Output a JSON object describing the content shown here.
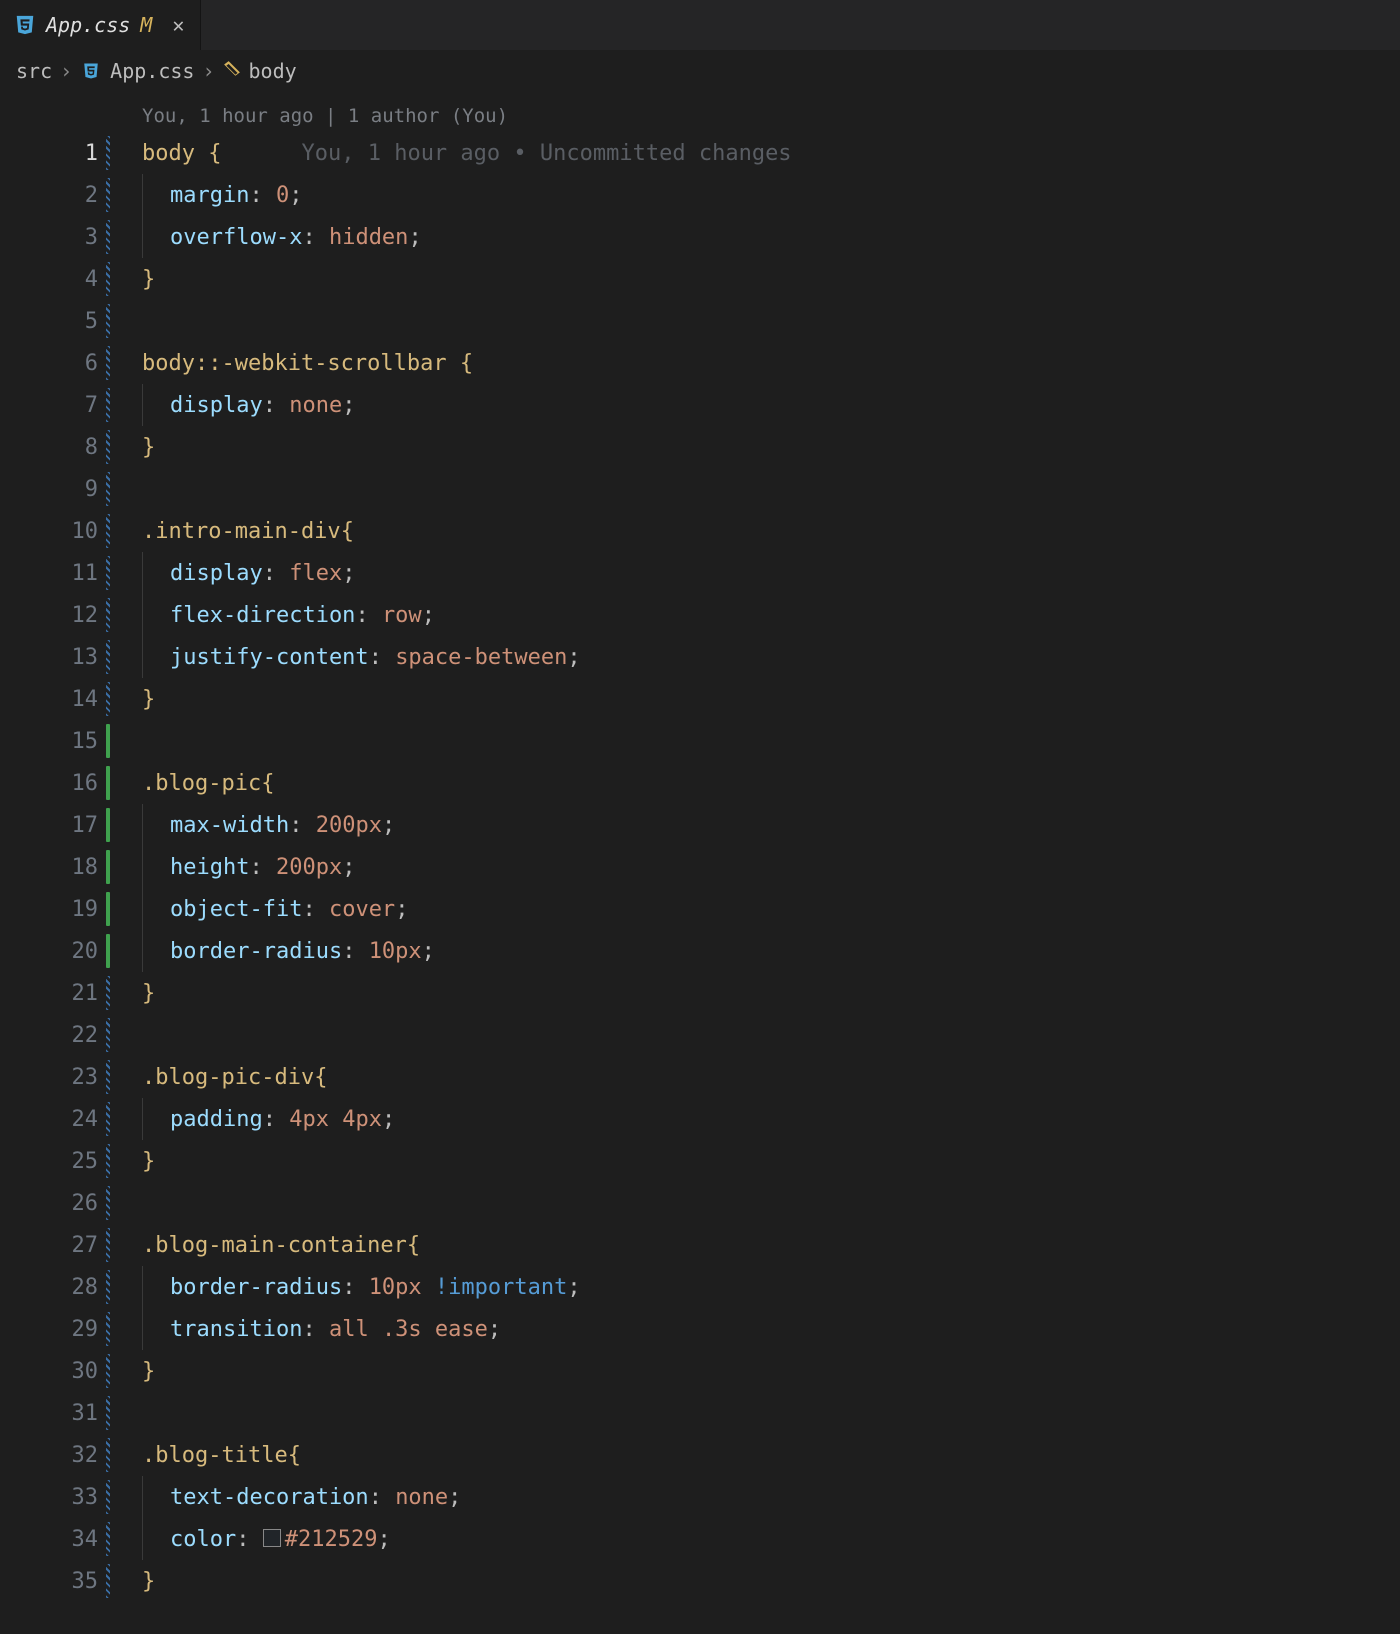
{
  "tab": {
    "filename": "App.css",
    "gitStatus": "M"
  },
  "breadcrumbs": {
    "folder": "src",
    "file": "App.css",
    "symbol": "body"
  },
  "gitlens": {
    "header": "You, 1 hour ago | 1 author (You)",
    "inline": "You, 1 hour ago • Uncommitted changes"
  },
  "lines": [
    {
      "n": 1,
      "decor": "hatch",
      "active": true,
      "tokens": [
        [
          "sel",
          "body "
        ],
        [
          "brace",
          "{"
        ]
      ],
      "gitlensInline": true
    },
    {
      "n": 2,
      "decor": "hatch",
      "indent": 1,
      "tokens": [
        [
          "prop",
          "margin"
        ],
        [
          "punct",
          ": "
        ],
        [
          "num",
          "0"
        ],
        [
          "punct",
          ";"
        ]
      ]
    },
    {
      "n": 3,
      "decor": "hatch",
      "indent": 1,
      "tokens": [
        [
          "prop",
          "overflow-x"
        ],
        [
          "punct",
          ": "
        ],
        [
          "val",
          "hidden"
        ],
        [
          "punct",
          ";"
        ]
      ]
    },
    {
      "n": 4,
      "decor": "hatch",
      "tokens": [
        [
          "brace",
          "}"
        ]
      ]
    },
    {
      "n": 5,
      "decor": "hatch",
      "tokens": []
    },
    {
      "n": 6,
      "decor": "hatch",
      "tokens": [
        [
          "sel",
          "body"
        ],
        [
          "pseudo",
          "::-webkit-scrollbar "
        ],
        [
          "brace",
          "{"
        ]
      ]
    },
    {
      "n": 7,
      "decor": "hatch",
      "indent": 1,
      "tokens": [
        [
          "prop",
          "display"
        ],
        [
          "punct",
          ": "
        ],
        [
          "val",
          "none"
        ],
        [
          "punct",
          ";"
        ]
      ]
    },
    {
      "n": 8,
      "decor": "hatch",
      "tokens": [
        [
          "brace",
          "}"
        ]
      ]
    },
    {
      "n": 9,
      "decor": "hatch",
      "tokens": []
    },
    {
      "n": 10,
      "decor": "hatch",
      "tokens": [
        [
          "class",
          ".intro-main-div"
        ],
        [
          "brace",
          "{"
        ]
      ]
    },
    {
      "n": 11,
      "decor": "hatch",
      "indent": 1,
      "tokens": [
        [
          "prop",
          "display"
        ],
        [
          "punct",
          ": "
        ],
        [
          "val",
          "flex"
        ],
        [
          "punct",
          ";"
        ]
      ]
    },
    {
      "n": 12,
      "decor": "hatch",
      "indent": 1,
      "tokens": [
        [
          "prop",
          "flex-direction"
        ],
        [
          "punct",
          ": "
        ],
        [
          "val",
          "row"
        ],
        [
          "punct",
          ";"
        ]
      ]
    },
    {
      "n": 13,
      "decor": "hatch",
      "indent": 1,
      "tokens": [
        [
          "prop",
          "justify-content"
        ],
        [
          "punct",
          ": "
        ],
        [
          "val",
          "space-between"
        ],
        [
          "punct",
          ";"
        ]
      ]
    },
    {
      "n": 14,
      "decor": "hatch",
      "tokens": [
        [
          "brace",
          "}"
        ]
      ]
    },
    {
      "n": 15,
      "decor": "green",
      "tokens": []
    },
    {
      "n": 16,
      "decor": "green",
      "tokens": [
        [
          "class",
          ".blog-pic"
        ],
        [
          "brace",
          "{"
        ]
      ]
    },
    {
      "n": 17,
      "decor": "green",
      "indent": 1,
      "tokens": [
        [
          "prop",
          "max-width"
        ],
        [
          "punct",
          ": "
        ],
        [
          "num",
          "200px"
        ],
        [
          "punct",
          ";"
        ]
      ]
    },
    {
      "n": 18,
      "decor": "green",
      "indent": 1,
      "tokens": [
        [
          "prop",
          "height"
        ],
        [
          "punct",
          ": "
        ],
        [
          "num",
          "200px"
        ],
        [
          "punct",
          ";"
        ]
      ]
    },
    {
      "n": 19,
      "decor": "green",
      "indent": 1,
      "tokens": [
        [
          "prop",
          "object-fit"
        ],
        [
          "punct",
          ": "
        ],
        [
          "val",
          "cover"
        ],
        [
          "punct",
          ";"
        ]
      ]
    },
    {
      "n": 20,
      "decor": "green",
      "indent": 1,
      "tokens": [
        [
          "prop",
          "border-radius"
        ],
        [
          "punct",
          ": "
        ],
        [
          "num",
          "10px"
        ],
        [
          "punct",
          ";"
        ]
      ]
    },
    {
      "n": 21,
      "decor": "hatch",
      "tokens": [
        [
          "brace",
          "}"
        ]
      ]
    },
    {
      "n": 22,
      "decor": "hatch",
      "tokens": []
    },
    {
      "n": 23,
      "decor": "hatch",
      "tokens": [
        [
          "class",
          ".blog-pic-div"
        ],
        [
          "brace",
          "{"
        ]
      ]
    },
    {
      "n": 24,
      "decor": "hatch",
      "indent": 1,
      "tokens": [
        [
          "prop",
          "padding"
        ],
        [
          "punct",
          ": "
        ],
        [
          "num",
          "4px 4px"
        ],
        [
          "punct",
          ";"
        ]
      ]
    },
    {
      "n": 25,
      "decor": "hatch",
      "tokens": [
        [
          "brace",
          "}"
        ]
      ]
    },
    {
      "n": 26,
      "decor": "hatch",
      "tokens": []
    },
    {
      "n": 27,
      "decor": "hatch",
      "tokens": [
        [
          "class",
          ".blog-main-container"
        ],
        [
          "brace",
          "{"
        ]
      ]
    },
    {
      "n": 28,
      "decor": "hatch",
      "indent": 1,
      "tokens": [
        [
          "prop",
          "border-radius"
        ],
        [
          "punct",
          ": "
        ],
        [
          "num",
          "10px "
        ],
        [
          "important",
          "!important"
        ],
        [
          "punct",
          ";"
        ]
      ]
    },
    {
      "n": 29,
      "decor": "hatch",
      "indent": 1,
      "tokens": [
        [
          "prop",
          "transition"
        ],
        [
          "punct",
          ": "
        ],
        [
          "val",
          "all "
        ],
        [
          "num",
          ".3s "
        ],
        [
          "val",
          "ease"
        ],
        [
          "punct",
          ";"
        ]
      ]
    },
    {
      "n": 30,
      "decor": "hatch",
      "tokens": [
        [
          "brace",
          "}"
        ]
      ]
    },
    {
      "n": 31,
      "decor": "hatch",
      "tokens": []
    },
    {
      "n": 32,
      "decor": "hatch",
      "tokens": [
        [
          "class",
          ".blog-title"
        ],
        [
          "brace",
          "{"
        ]
      ]
    },
    {
      "n": 33,
      "decor": "hatch",
      "indent": 1,
      "tokens": [
        [
          "prop",
          "text-decoration"
        ],
        [
          "punct",
          ": "
        ],
        [
          "val",
          "none"
        ],
        [
          "punct",
          ";"
        ]
      ]
    },
    {
      "n": 34,
      "decor": "hatch",
      "indent": 1,
      "tokens": [
        [
          "prop",
          "color"
        ],
        [
          "punct",
          ": "
        ],
        [
          "swatch",
          "#212529"
        ],
        [
          "val",
          "#212529"
        ],
        [
          "punct",
          ";"
        ]
      ]
    },
    {
      "n": 35,
      "decor": "hatch",
      "tokens": [
        [
          "brace",
          "}"
        ]
      ]
    }
  ]
}
